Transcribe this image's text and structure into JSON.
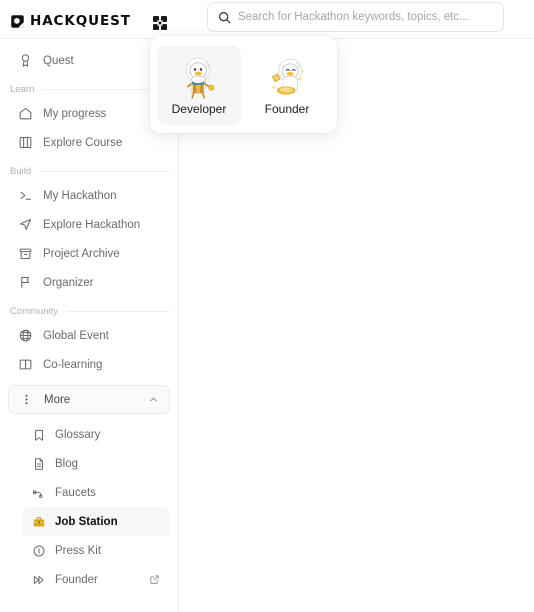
{
  "header": {
    "logo_text": "HACKQUEST",
    "logo_icon": "hackquest-logo-mark",
    "grid_icon": "grid-apps-icon",
    "search": {
      "placeholder": "Search for Hackathon keywords, topics, etc...",
      "value": "",
      "icon": "search-icon"
    }
  },
  "sidebar": {
    "top_items": [
      {
        "label": "Quest",
        "icon": "medal-icon"
      }
    ],
    "sections": [
      {
        "title": "Learn",
        "items": [
          {
            "label": "My progress",
            "icon": "home-icon"
          },
          {
            "label": "Explore Course",
            "icon": "book-map-icon"
          }
        ]
      },
      {
        "title": "Build",
        "items": [
          {
            "label": "My Hackathon",
            "icon": "terminal-icon"
          },
          {
            "label": "Explore Hackathon",
            "icon": "navigation-send-icon"
          },
          {
            "label": "Project Archive",
            "icon": "archive-box-icon"
          },
          {
            "label": "Organizer",
            "icon": "flag-icon"
          }
        ]
      },
      {
        "title": "Community",
        "items": [
          {
            "label": "Global Event",
            "icon": "globe-icon"
          },
          {
            "label": "Co-learning",
            "icon": "open-book-icon"
          }
        ]
      }
    ],
    "more": {
      "label": "More",
      "icon": "vertical-dots-icon",
      "chevron": "chevron-up-icon",
      "expanded": true,
      "items": [
        {
          "label": "Glossary",
          "icon": "bookmark-icon",
          "active": false,
          "external": false
        },
        {
          "label": "Blog",
          "icon": "document-icon",
          "active": false,
          "external": false
        },
        {
          "label": "Faucets",
          "icon": "faucet-icon",
          "active": false,
          "external": false
        },
        {
          "label": "Job Station",
          "icon": "briefcase-icon",
          "active": true,
          "external": false
        },
        {
          "label": "Press Kit",
          "icon": "info-circle-icon",
          "active": false,
          "external": false
        },
        {
          "label": "Founder",
          "icon": "double-play-icon",
          "active": false,
          "external": true
        }
      ]
    }
  },
  "role_popup": {
    "roles": [
      {
        "label": "Developer",
        "art": "duck-astronaut-developer-mascot",
        "selected": true
      },
      {
        "label": "Founder",
        "art": "duck-astronaut-founder-mascot",
        "selected": false
      }
    ]
  },
  "colors": {
    "accent_gold": "#D6A81C",
    "text_primary": "#111111",
    "text_muted": "#6b6b6b",
    "border": "#ededed",
    "active_bg": "#f7f7f7"
  }
}
